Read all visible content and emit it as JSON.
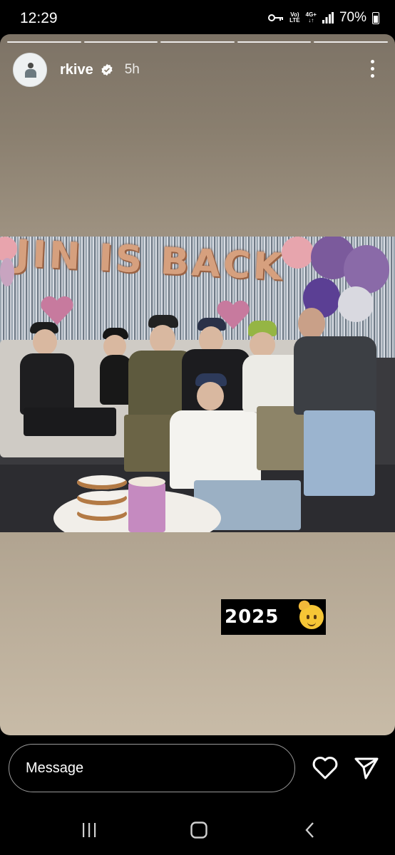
{
  "status_bar": {
    "time": "12:29",
    "network_top": "Vo)",
    "network_bottom": "LTE",
    "signal_top": "4G+",
    "battery": "70%"
  },
  "story": {
    "username": "rkive",
    "time_ago": "5h",
    "segments": 5,
    "photo_banner": "JIN IS BACK",
    "sticker_text": "2025",
    "icons": [
      "key-icon",
      "verified-badge-icon",
      "more-icon",
      "saluting-face-emoji"
    ]
  },
  "reply": {
    "placeholder": "Message"
  },
  "icons": {
    "like": "heart-icon",
    "share": "send-icon",
    "nav": [
      "recents-icon",
      "home-icon",
      "back-icon"
    ]
  },
  "colors": {
    "background": "#000000",
    "verified": "#ffffff"
  }
}
